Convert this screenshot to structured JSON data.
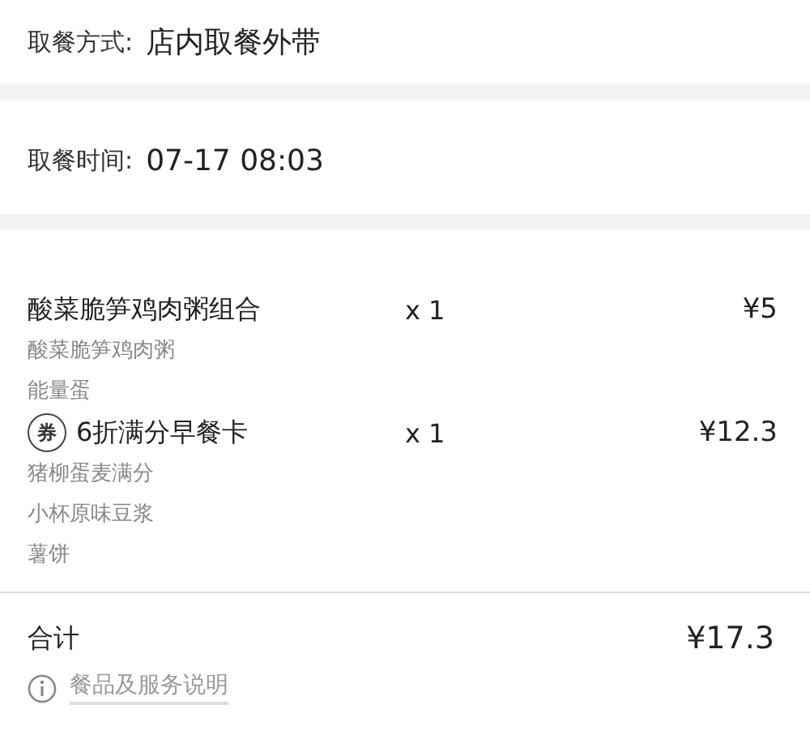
{
  "pickup_method": {
    "label": "取餐方式:",
    "value": "店内取餐外带"
  },
  "pickup_time": {
    "label": "取餐时间:",
    "value": "07-17 08:03"
  },
  "items": [
    {
      "name": "酸菜脆笋鸡肉粥组合",
      "quantity": "x 1",
      "price": "¥5",
      "components": [
        "酸菜脆笋鸡肉粥",
        "能量蛋"
      ]
    },
    {
      "badge": "券",
      "name": "6折满分早餐卡",
      "quantity": "x 1",
      "price": "¥12.3",
      "components": [
        "猪柳蛋麦满分",
        "小杯原味豆浆",
        "薯饼"
      ]
    }
  ],
  "total": {
    "label": "合计",
    "amount": "¥17.3"
  },
  "service_note": {
    "link": "餐品及服务说明"
  }
}
